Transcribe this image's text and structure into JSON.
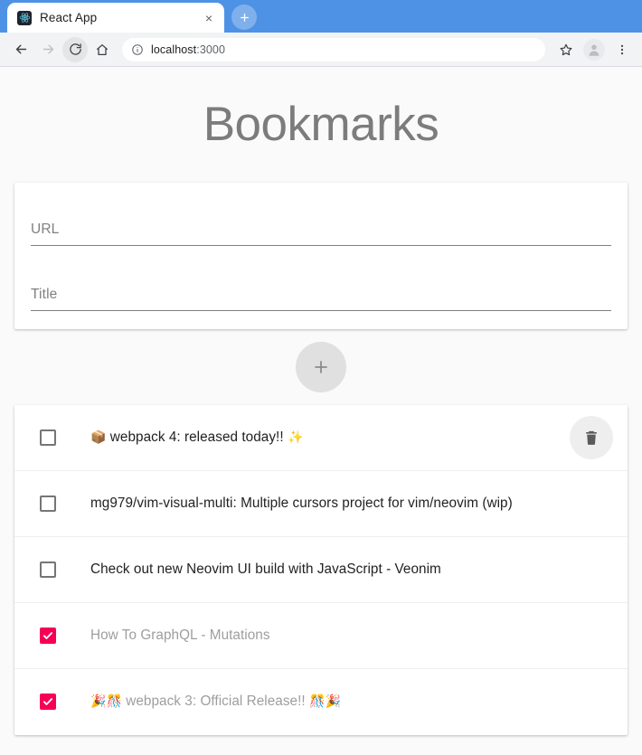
{
  "browser": {
    "tab": {
      "title": "React App",
      "favicon_name": "react-logo-icon",
      "close_label": "×"
    },
    "new_tab_label": "+",
    "toolbar": {
      "back_icon": "back-arrow-icon",
      "forward_icon": "forward-arrow-icon",
      "reload_icon": "reload-icon",
      "home_icon": "home-icon",
      "info_icon": "page-info-icon",
      "url_host": "localhost",
      "url_port": ":3000",
      "star_icon": "bookmark-star-icon",
      "profile_icon": "profile-avatar-icon",
      "menu_icon": "three-dot-menu-icon"
    }
  },
  "app": {
    "title": "Bookmarks",
    "form": {
      "url_placeholder": "URL",
      "url_value": "",
      "title_placeholder": "Title",
      "title_value": "",
      "add_button_label": "+"
    },
    "list": [
      {
        "prefix_emoji": "📦",
        "text": "webpack 4: released today!!",
        "suffix_emoji": "✨",
        "checked": false,
        "delete_visible": true
      },
      {
        "prefix_emoji": "",
        "text": "mg979/vim-visual-multi: Multiple cursors project for vim/neovim (wip)",
        "suffix_emoji": "",
        "checked": false,
        "delete_visible": false
      },
      {
        "prefix_emoji": "",
        "text": "Check out new Neovim UI build with JavaScript - Veonim",
        "suffix_emoji": "",
        "checked": false,
        "delete_visible": false
      },
      {
        "prefix_emoji": "",
        "text": "How To GraphQL - Mutations",
        "suffix_emoji": "",
        "checked": true,
        "delete_visible": false
      },
      {
        "prefix_emoji": "🎉🎊",
        "text": "webpack 3: Official Release!!",
        "suffix_emoji": "🎊🎉",
        "checked": true,
        "delete_visible": false
      }
    ],
    "colors": {
      "page_background": "#fafafa",
      "card_background": "#ffffff",
      "title_text": "#7c7c7c",
      "checkbox_checked": "#f50057",
      "fab_background": "#e0e0e0",
      "item_text": "#222222",
      "item_text_done": "#9e9e9e"
    }
  }
}
